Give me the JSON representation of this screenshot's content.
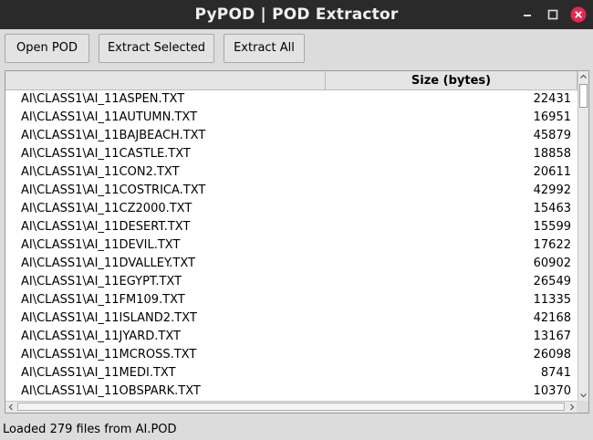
{
  "window": {
    "title": "PyPOD | POD Extractor",
    "controls": [
      "minimize-icon",
      "maximize-icon",
      "close-icon"
    ],
    "close_color": "#e8264f"
  },
  "toolbar": {
    "open_label": "Open POD",
    "extract_selected_label": "Extract Selected",
    "extract_all_label": "Extract All"
  },
  "table": {
    "columns": [
      "",
      "Size (bytes)"
    ],
    "rows": [
      {
        "name": "AI\\CLASS1\\AI_11ASPEN.TXT",
        "size": "22431"
      },
      {
        "name": "AI\\CLASS1\\AI_11AUTUMN.TXT",
        "size": "16951"
      },
      {
        "name": "AI\\CLASS1\\AI_11BAJBEACH.TXT",
        "size": "45879"
      },
      {
        "name": "AI\\CLASS1\\AI_11CASTLE.TXT",
        "size": "18858"
      },
      {
        "name": "AI\\CLASS1\\AI_11CON2.TXT",
        "size": "20611"
      },
      {
        "name": "AI\\CLASS1\\AI_11COSTRICA.TXT",
        "size": "42992"
      },
      {
        "name": "AI\\CLASS1\\AI_11CZ2000.TXT",
        "size": "15463"
      },
      {
        "name": "AI\\CLASS1\\AI_11DESERT.TXT",
        "size": "15599"
      },
      {
        "name": "AI\\CLASS1\\AI_11DEVIL.TXT",
        "size": "17622"
      },
      {
        "name": "AI\\CLASS1\\AI_11DVALLEY.TXT",
        "size": "60902"
      },
      {
        "name": "AI\\CLASS1\\AI_11EGYPT.TXT",
        "size": "26549"
      },
      {
        "name": "AI\\CLASS1\\AI_11FM109.TXT",
        "size": "11335"
      },
      {
        "name": "AI\\CLASS1\\AI_11ISLAND2.TXT",
        "size": "42168"
      },
      {
        "name": "AI\\CLASS1\\AI_11JYARD.TXT",
        "size": "13167"
      },
      {
        "name": "AI\\CLASS1\\AI_11MCROSS.TXT",
        "size": "26098"
      },
      {
        "name": "AI\\CLASS1\\AI_11MEDI.TXT",
        "size": "8741"
      },
      {
        "name": "AI\\CLASS1\\AI_11OBSPARK.TXT",
        "size": "10370"
      }
    ]
  },
  "status": {
    "text": "Loaded 279 files from AI.POD"
  }
}
